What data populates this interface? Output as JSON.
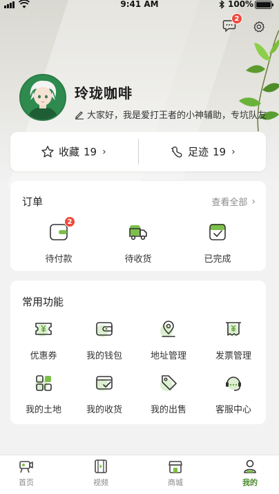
{
  "status_bar": {
    "time": "9:41 AM",
    "battery": "100%"
  },
  "colors": {
    "accent": "#4a8a2c",
    "icon_green": "#6aa843",
    "badge": "#ef4a3c"
  },
  "header": {
    "messages_badge": "2"
  },
  "profile": {
    "name": "玲珑咖啡",
    "bio": "大家好，我是爱打王者的小神辅助，专坑队友"
  },
  "stats": {
    "favorites": {
      "label": "收藏",
      "count": "19"
    },
    "footprints": {
      "label": "足迹",
      "count": "19"
    }
  },
  "orders": {
    "title": "订单",
    "view_all": "查看全部",
    "items": [
      {
        "label": "待付款",
        "icon": "wallet-pay-icon",
        "badge": "2"
      },
      {
        "label": "待收货",
        "icon": "truck-icon"
      },
      {
        "label": "已完成",
        "icon": "check-box-icon"
      }
    ]
  },
  "functions": {
    "title": "常用功能",
    "items": [
      {
        "label": "优惠券",
        "icon": "coupon-icon"
      },
      {
        "label": "我的钱包",
        "icon": "wallet-icon"
      },
      {
        "label": "地址管理",
        "icon": "location-icon"
      },
      {
        "label": "发票管理",
        "icon": "invoice-icon"
      },
      {
        "label": "我的土地",
        "icon": "grid-icon"
      },
      {
        "label": "我的收货",
        "icon": "received-icon"
      },
      {
        "label": "我的出售",
        "icon": "tag-icon"
      },
      {
        "label": "客服中心",
        "icon": "headset-icon"
      }
    ]
  },
  "tabs": [
    {
      "label": "首页",
      "icon": "home-cinema-icon",
      "active": false
    },
    {
      "label": "视频",
      "icon": "video-icon",
      "active": false
    },
    {
      "label": "商城",
      "icon": "shop-icon",
      "active": false
    },
    {
      "label": "我的",
      "icon": "profile-icon",
      "active": true
    }
  ]
}
